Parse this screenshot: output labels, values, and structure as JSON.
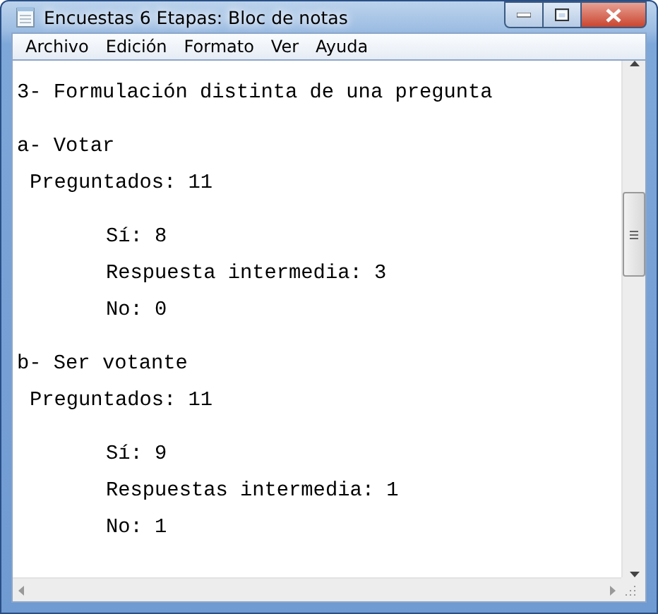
{
  "window": {
    "title": "Encuestas 6 Etapas: Bloc de notas"
  },
  "menu": [
    "Archivo",
    "Edición",
    "Formato",
    "Ver",
    "Ayuda"
  ],
  "document": {
    "heading": "3- Formulación distinta de una pregunta",
    "sections": [
      {
        "label": "a- Votar",
        "asked": "Preguntados: 11",
        "answers": [
          "Sí: 8",
          "Respuesta intermedia: 3",
          "No: 0"
        ]
      },
      {
        "label": "b- Ser votante",
        "asked": "Preguntados: 11",
        "answers": [
          "Sí: 9",
          "Respuestas intermedia: 1",
          "No: 1"
        ]
      }
    ]
  }
}
